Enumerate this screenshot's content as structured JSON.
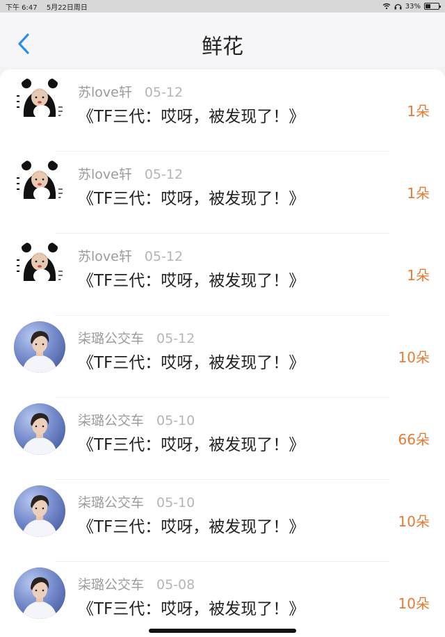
{
  "status_bar": {
    "time": "下午 6:47",
    "date": "5月22日周日",
    "battery": "33%"
  },
  "header": {
    "title": "鲜花",
    "back_icon": "chevron-left-icon"
  },
  "rows": [
    {
      "user": "苏love轩",
      "date": "05-12",
      "title": "《TF三代：哎呀，被发现了！》",
      "amount": "1朵",
      "avatar": "panda"
    },
    {
      "user": "苏love轩",
      "date": "05-12",
      "title": "《TF三代：哎呀，被发现了！》",
      "amount": "1朵",
      "avatar": "panda"
    },
    {
      "user": "苏love轩",
      "date": "05-12",
      "title": "《TF三代：哎呀，被发现了！》",
      "amount": "1朵",
      "avatar": "panda"
    },
    {
      "user": "柒璐公交车",
      "date": "05-12",
      "title": "《TF三代：哎呀，被发现了！》",
      "amount": "10朵",
      "avatar": "boy"
    },
    {
      "user": "柒璐公交车",
      "date": "05-10",
      "title": "《TF三代：哎呀，被发现了！》",
      "amount": "66朵",
      "avatar": "boy"
    },
    {
      "user": "柒璐公交车",
      "date": "05-10",
      "title": "《TF三代：哎呀，被发现了！》",
      "amount": "10朵",
      "avatar": "boy"
    },
    {
      "user": "柒璐公交车",
      "date": "05-08",
      "title": "《TF三代：哎呀，被发现了！》",
      "amount": "10朵",
      "avatar": "boy"
    }
  ],
  "colors": {
    "accent": "#2a8ef0",
    "amount": "#ea7a32",
    "meta": "#9b9b9b"
  }
}
